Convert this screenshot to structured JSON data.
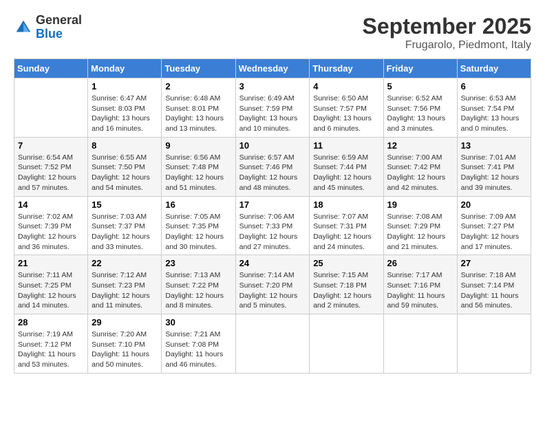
{
  "header": {
    "logo": {
      "general": "General",
      "blue": "Blue"
    },
    "title": "September 2025",
    "location": "Frugarolo, Piedmont, Italy"
  },
  "weekdays": [
    "Sunday",
    "Monday",
    "Tuesday",
    "Wednesday",
    "Thursday",
    "Friday",
    "Saturday"
  ],
  "weeks": [
    [
      null,
      {
        "day": "1",
        "sunrise": "6:47 AM",
        "sunset": "8:03 PM",
        "daylight": "13 hours and 16 minutes."
      },
      {
        "day": "2",
        "sunrise": "6:48 AM",
        "sunset": "8:01 PM",
        "daylight": "13 hours and 13 minutes."
      },
      {
        "day": "3",
        "sunrise": "6:49 AM",
        "sunset": "7:59 PM",
        "daylight": "13 hours and 10 minutes."
      },
      {
        "day": "4",
        "sunrise": "6:50 AM",
        "sunset": "7:57 PM",
        "daylight": "13 hours and 6 minutes."
      },
      {
        "day": "5",
        "sunrise": "6:52 AM",
        "sunset": "7:56 PM",
        "daylight": "13 hours and 3 minutes."
      },
      {
        "day": "6",
        "sunrise": "6:53 AM",
        "sunset": "7:54 PM",
        "daylight": "13 hours and 0 minutes."
      }
    ],
    [
      {
        "day": "7",
        "sunrise": "6:54 AM",
        "sunset": "7:52 PM",
        "daylight": "12 hours and 57 minutes."
      },
      {
        "day": "8",
        "sunrise": "6:55 AM",
        "sunset": "7:50 PM",
        "daylight": "12 hours and 54 minutes."
      },
      {
        "day": "9",
        "sunrise": "6:56 AM",
        "sunset": "7:48 PM",
        "daylight": "12 hours and 51 minutes."
      },
      {
        "day": "10",
        "sunrise": "6:57 AM",
        "sunset": "7:46 PM",
        "daylight": "12 hours and 48 minutes."
      },
      {
        "day": "11",
        "sunrise": "6:59 AM",
        "sunset": "7:44 PM",
        "daylight": "12 hours and 45 minutes."
      },
      {
        "day": "12",
        "sunrise": "7:00 AM",
        "sunset": "7:42 PM",
        "daylight": "12 hours and 42 minutes."
      },
      {
        "day": "13",
        "sunrise": "7:01 AM",
        "sunset": "7:41 PM",
        "daylight": "12 hours and 39 minutes."
      }
    ],
    [
      {
        "day": "14",
        "sunrise": "7:02 AM",
        "sunset": "7:39 PM",
        "daylight": "12 hours and 36 minutes."
      },
      {
        "day": "15",
        "sunrise": "7:03 AM",
        "sunset": "7:37 PM",
        "daylight": "12 hours and 33 minutes."
      },
      {
        "day": "16",
        "sunrise": "7:05 AM",
        "sunset": "7:35 PM",
        "daylight": "12 hours and 30 minutes."
      },
      {
        "day": "17",
        "sunrise": "7:06 AM",
        "sunset": "7:33 PM",
        "daylight": "12 hours and 27 minutes."
      },
      {
        "day": "18",
        "sunrise": "7:07 AM",
        "sunset": "7:31 PM",
        "daylight": "12 hours and 24 minutes."
      },
      {
        "day": "19",
        "sunrise": "7:08 AM",
        "sunset": "7:29 PM",
        "daylight": "12 hours and 21 minutes."
      },
      {
        "day": "20",
        "sunrise": "7:09 AM",
        "sunset": "7:27 PM",
        "daylight": "12 hours and 17 minutes."
      }
    ],
    [
      {
        "day": "21",
        "sunrise": "7:11 AM",
        "sunset": "7:25 PM",
        "daylight": "12 hours and 14 minutes."
      },
      {
        "day": "22",
        "sunrise": "7:12 AM",
        "sunset": "7:23 PM",
        "daylight": "12 hours and 11 minutes."
      },
      {
        "day": "23",
        "sunrise": "7:13 AM",
        "sunset": "7:22 PM",
        "daylight": "12 hours and 8 minutes."
      },
      {
        "day": "24",
        "sunrise": "7:14 AM",
        "sunset": "7:20 PM",
        "daylight": "12 hours and 5 minutes."
      },
      {
        "day": "25",
        "sunrise": "7:15 AM",
        "sunset": "7:18 PM",
        "daylight": "12 hours and 2 minutes."
      },
      {
        "day": "26",
        "sunrise": "7:17 AM",
        "sunset": "7:16 PM",
        "daylight": "11 hours and 59 minutes."
      },
      {
        "day": "27",
        "sunrise": "7:18 AM",
        "sunset": "7:14 PM",
        "daylight": "11 hours and 56 minutes."
      }
    ],
    [
      {
        "day": "28",
        "sunrise": "7:19 AM",
        "sunset": "7:12 PM",
        "daylight": "11 hours and 53 minutes."
      },
      {
        "day": "29",
        "sunrise": "7:20 AM",
        "sunset": "7:10 PM",
        "daylight": "11 hours and 50 minutes."
      },
      {
        "day": "30",
        "sunrise": "7:21 AM",
        "sunset": "7:08 PM",
        "daylight": "11 hours and 46 minutes."
      },
      null,
      null,
      null,
      null
    ]
  ],
  "labels": {
    "sunrise": "Sunrise:",
    "sunset": "Sunset:",
    "daylight": "Daylight:"
  }
}
